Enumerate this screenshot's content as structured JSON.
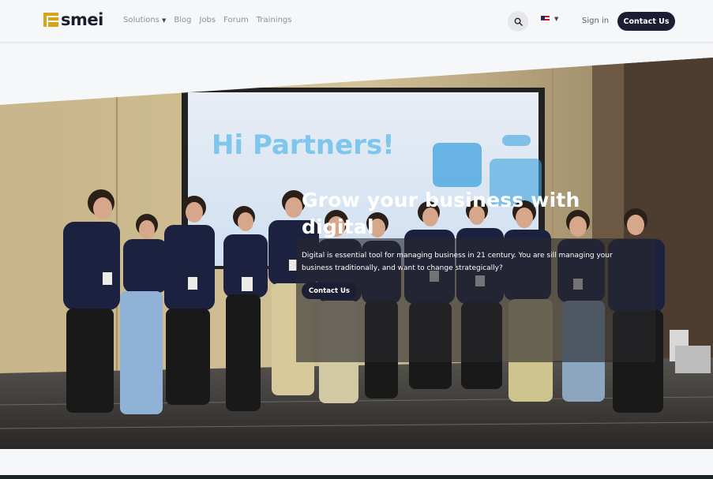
{
  "header": {
    "logo_text": "smei",
    "nav": [
      {
        "label": "Solutions",
        "has_dropdown": true
      },
      {
        "label": "Blog"
      },
      {
        "label": "Jobs"
      },
      {
        "label": "Forum"
      },
      {
        "label": "Trainings"
      }
    ],
    "search_icon": "search-icon",
    "language_flag": "us-flag-icon",
    "sign_in_label": "Sign in",
    "contact_label": "Contact Us"
  },
  "hero": {
    "title": "Grow your business with digital",
    "description": "Digital is essential tool for managing business in 21 century. You are sill managing your business traditionally, and want to change strategically?",
    "button_label": "Contact Us",
    "screen_text": "Hi Partners!"
  },
  "colors": {
    "brand_gold": "#d9a21b",
    "dark_navy": "#1c1f33",
    "page_bg": "#f6f7f9"
  }
}
